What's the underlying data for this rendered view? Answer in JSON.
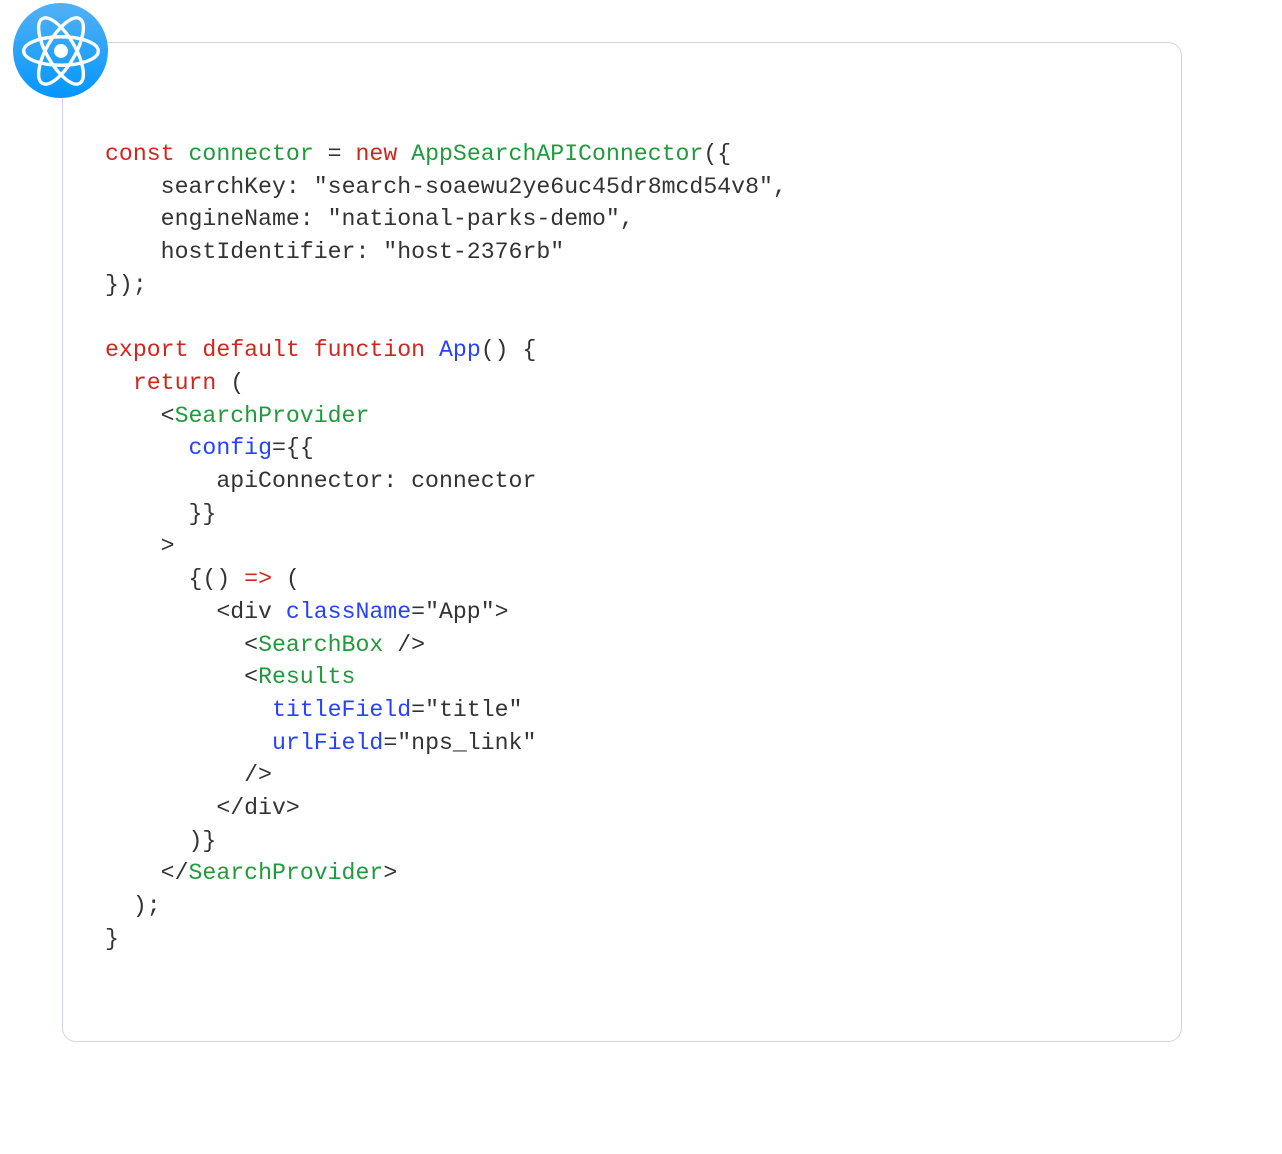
{
  "code": {
    "tokens": [
      {
        "t": "const",
        "c": "kw"
      },
      {
        "t": " ",
        "c": ""
      },
      {
        "t": "connector",
        "c": "ident"
      },
      {
        "t": " = ",
        "c": ""
      },
      {
        "t": "new",
        "c": "kw"
      },
      {
        "t": " ",
        "c": ""
      },
      {
        "t": "AppSearchAPIConnector",
        "c": "ident"
      },
      {
        "t": "({",
        "c": ""
      },
      {
        "t": "\n",
        "c": ""
      },
      {
        "t": "    searchKey: ",
        "c": ""
      },
      {
        "t": "\"search-soaewu2ye6uc45dr8mcd54v8\"",
        "c": "str"
      },
      {
        "t": ",",
        "c": ""
      },
      {
        "t": "\n",
        "c": ""
      },
      {
        "t": "    engineName: ",
        "c": ""
      },
      {
        "t": "\"national-parks-demo\"",
        "c": "str"
      },
      {
        "t": ",",
        "c": ""
      },
      {
        "t": "\n",
        "c": ""
      },
      {
        "t": "    hostIdentifier: ",
        "c": ""
      },
      {
        "t": "\"host-2376rb\"",
        "c": "str"
      },
      {
        "t": "\n",
        "c": ""
      },
      {
        "t": "});",
        "c": ""
      },
      {
        "t": "\n",
        "c": ""
      },
      {
        "t": "\n",
        "c": ""
      },
      {
        "t": "export",
        "c": "kw"
      },
      {
        "t": " ",
        "c": ""
      },
      {
        "t": "default",
        "c": "kw"
      },
      {
        "t": " ",
        "c": ""
      },
      {
        "t": "function",
        "c": "kw"
      },
      {
        "t": " ",
        "c": ""
      },
      {
        "t": "App",
        "c": "func"
      },
      {
        "t": "() {",
        "c": ""
      },
      {
        "t": "\n",
        "c": ""
      },
      {
        "t": "  ",
        "c": ""
      },
      {
        "t": "return",
        "c": "kw"
      },
      {
        "t": " (",
        "c": ""
      },
      {
        "t": "\n",
        "c": ""
      },
      {
        "t": "    <",
        "c": ""
      },
      {
        "t": "SearchProvider",
        "c": "ident"
      },
      {
        "t": "\n",
        "c": ""
      },
      {
        "t": "      ",
        "c": ""
      },
      {
        "t": "config",
        "c": "attr"
      },
      {
        "t": "={{",
        "c": ""
      },
      {
        "t": "\n",
        "c": ""
      },
      {
        "t": "        apiConnector: ",
        "c": ""
      },
      {
        "t": "connector",
        "c": ""
      },
      {
        "t": "\n",
        "c": ""
      },
      {
        "t": "      }}",
        "c": ""
      },
      {
        "t": "\n",
        "c": ""
      },
      {
        "t": "    >",
        "c": ""
      },
      {
        "t": "\n",
        "c": ""
      },
      {
        "t": "      {() ",
        "c": ""
      },
      {
        "t": "=>",
        "c": "kw"
      },
      {
        "t": " (",
        "c": ""
      },
      {
        "t": "\n",
        "c": ""
      },
      {
        "t": "        <div ",
        "c": ""
      },
      {
        "t": "className",
        "c": "attr"
      },
      {
        "t": "=",
        "c": ""
      },
      {
        "t": "\"App\"",
        "c": "str"
      },
      {
        "t": ">",
        "c": ""
      },
      {
        "t": "\n",
        "c": ""
      },
      {
        "t": "          <",
        "c": ""
      },
      {
        "t": "SearchBox",
        "c": "ident"
      },
      {
        "t": " />",
        "c": ""
      },
      {
        "t": "\n",
        "c": ""
      },
      {
        "t": "          <",
        "c": ""
      },
      {
        "t": "Results",
        "c": "ident"
      },
      {
        "t": "\n",
        "c": ""
      },
      {
        "t": "            ",
        "c": ""
      },
      {
        "t": "titleField",
        "c": "attr"
      },
      {
        "t": "=",
        "c": ""
      },
      {
        "t": "\"title\"",
        "c": "str"
      },
      {
        "t": "\n",
        "c": ""
      },
      {
        "t": "            ",
        "c": ""
      },
      {
        "t": "urlField",
        "c": "attr"
      },
      {
        "t": "=",
        "c": ""
      },
      {
        "t": "\"nps_link\"",
        "c": "str"
      },
      {
        "t": "\n",
        "c": ""
      },
      {
        "t": "          />",
        "c": ""
      },
      {
        "t": "\n",
        "c": ""
      },
      {
        "t": "        </div>",
        "c": ""
      },
      {
        "t": "\n",
        "c": ""
      },
      {
        "t": "      )}",
        "c": ""
      },
      {
        "t": "\n",
        "c": ""
      },
      {
        "t": "    </",
        "c": ""
      },
      {
        "t": "SearchProvider",
        "c": "ident"
      },
      {
        "t": ">",
        "c": ""
      },
      {
        "t": "\n",
        "c": ""
      },
      {
        "t": "  );",
        "c": ""
      },
      {
        "t": "\n",
        "c": ""
      },
      {
        "t": "}",
        "c": ""
      }
    ]
  },
  "icon": {
    "name": "react-icon"
  }
}
